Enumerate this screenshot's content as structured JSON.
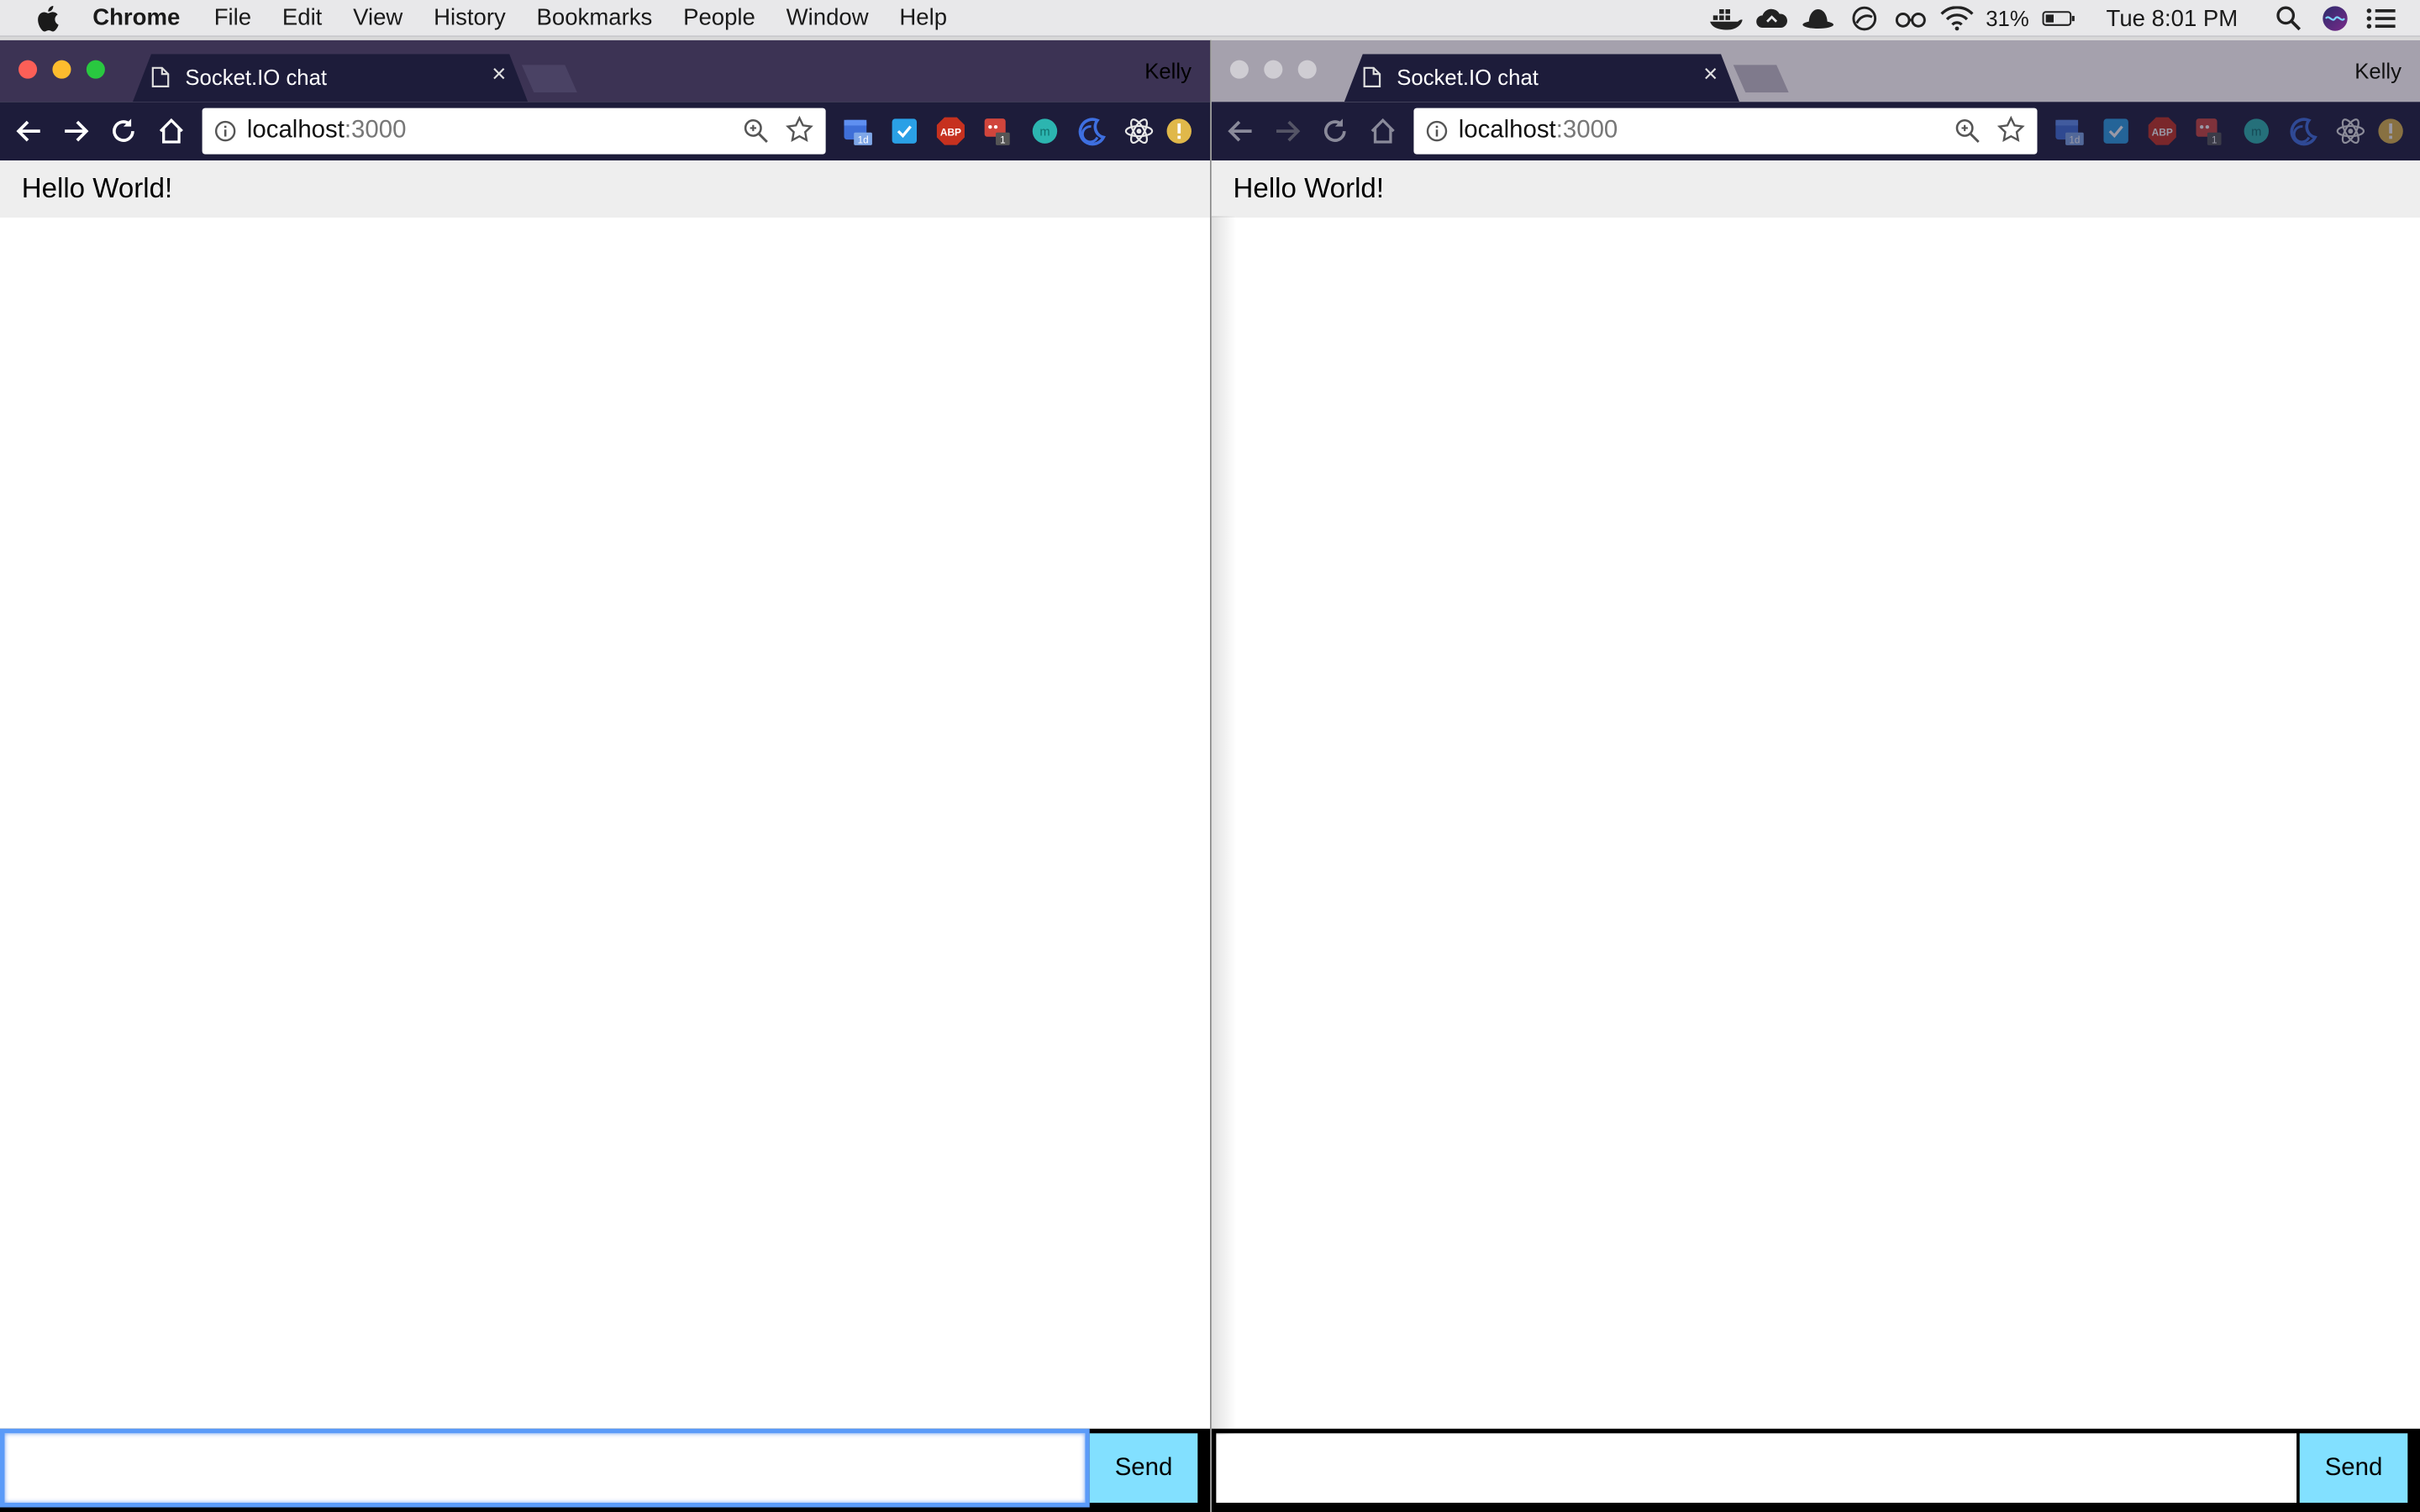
{
  "menubar": {
    "app_name": "Chrome",
    "items": [
      "File",
      "Edit",
      "View",
      "History",
      "Bookmarks",
      "People",
      "Window",
      "Help"
    ],
    "battery_percent": "31%",
    "clock": "Tue 8:01 PM"
  },
  "windows": [
    {
      "id": "left",
      "tab_title": "Socket.IO chat",
      "profile_name": "Kelly",
      "url_host": "localhost",
      "url_port": ":3000",
      "messages": [
        "Hello World!"
      ],
      "input_value": "",
      "send_label": "Send",
      "focused": true
    },
    {
      "id": "right",
      "tab_title": "Socket.IO chat",
      "profile_name": "Kelly",
      "url_host": "localhost",
      "url_port": ":3000",
      "messages": [
        "Hello World!"
      ],
      "input_value": "",
      "send_label": "Send",
      "focused": false
    }
  ],
  "extensions": [
    {
      "name": "calendar-extension-icon",
      "badge": "1d",
      "color": "#3f6fd8"
    },
    {
      "name": "todo-extension-icon",
      "badge": "",
      "color": "#2aa0e6"
    },
    {
      "name": "adblock-plus-icon",
      "badge": "",
      "label": "ABP",
      "color": "#c6311f"
    },
    {
      "name": "notification-extension-icon",
      "badge": "1",
      "color": "#d0453c"
    },
    {
      "name": "teal-circle-extension-icon",
      "badge": "",
      "color": "#2cb5b0"
    },
    {
      "name": "moon-extension-icon",
      "badge": "",
      "color": "#3e6fe0"
    },
    {
      "name": "react-devtools-icon",
      "badge": "",
      "color": "#e8e8e8"
    },
    {
      "name": "warning-extension-icon",
      "badge": "",
      "color": "#e0b84a"
    }
  ]
}
